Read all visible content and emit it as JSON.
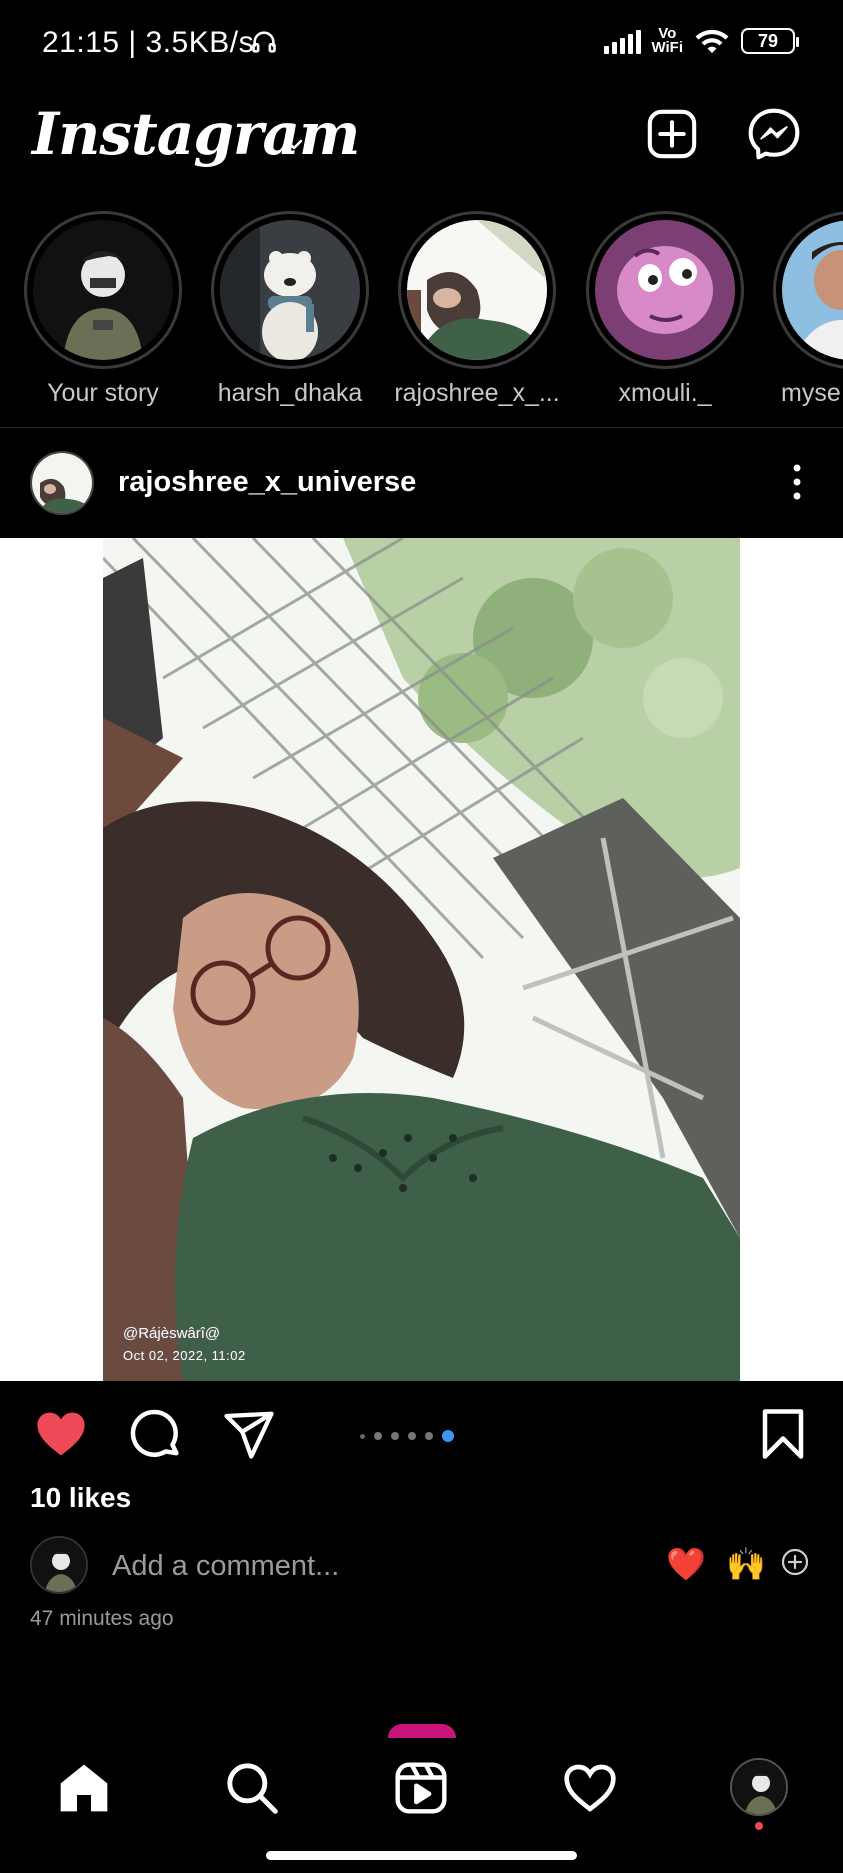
{
  "status_bar": {
    "time_speed": "21:15 | 3.5KB/s",
    "network": "Vo\nWiFi",
    "battery": "79"
  },
  "header": {
    "logo": "Instagram",
    "icons": [
      "chevron-down-icon",
      "new-post-icon",
      "messenger-icon"
    ]
  },
  "stories": [
    {
      "label": "Your story"
    },
    {
      "label": "harsh_dhaka"
    },
    {
      "label": "rajoshree_x_..."
    },
    {
      "label": "xmouli._"
    },
    {
      "label": "myse"
    }
  ],
  "post": {
    "username": "rajoshree_x_universe",
    "watermark_name": "@Rájèswârî@",
    "watermark_date": "Oct 02, 2022, 11:02",
    "likes": "10 likes",
    "comment_placeholder": "Add a comment...",
    "quick_emojis": [
      "❤️",
      "🙌"
    ],
    "time_ago": "47 minutes ago",
    "carousel": {
      "count": 6,
      "active": 6
    },
    "liked": true
  },
  "colors": {
    "background": "#000000",
    "like_red": "#ed4956",
    "carousel_active": "#3897f0",
    "secondary_text": "#9a9a9a"
  },
  "bottom_nav": [
    "home-icon",
    "search-icon",
    "reels-icon",
    "heart-icon",
    "profile-avatar"
  ]
}
